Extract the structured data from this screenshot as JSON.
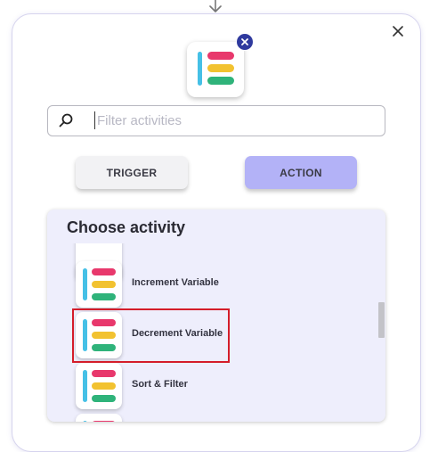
{
  "search": {
    "placeholder": "Filter activities",
    "value": ""
  },
  "tabs": {
    "trigger_label": "TRIGGER",
    "action_label": "ACTION",
    "selected": "ACTION"
  },
  "choose": {
    "title": "Choose activity",
    "items": [
      {
        "label": ""
      },
      {
        "label": "Increment Variable"
      },
      {
        "label": "Decrement Variable",
        "highlighted": true
      },
      {
        "label": "Sort & Filter"
      },
      {
        "label": ""
      }
    ]
  },
  "colors": {
    "accent": "#b3b2f7",
    "highlight": "#d41d2a",
    "icon_bar_blue": "#45c0e6",
    "icon_bar_red": "#e8386c",
    "icon_bar_yellow": "#f2c230",
    "icon_bar_green": "#2fb37a",
    "badge": "#2f3a9e"
  },
  "icons": {
    "top": "arrow-down-icon",
    "close": "close-icon",
    "app": "elementor-logo-icon",
    "remove": "remove-badge-icon",
    "search": "search-icon"
  }
}
